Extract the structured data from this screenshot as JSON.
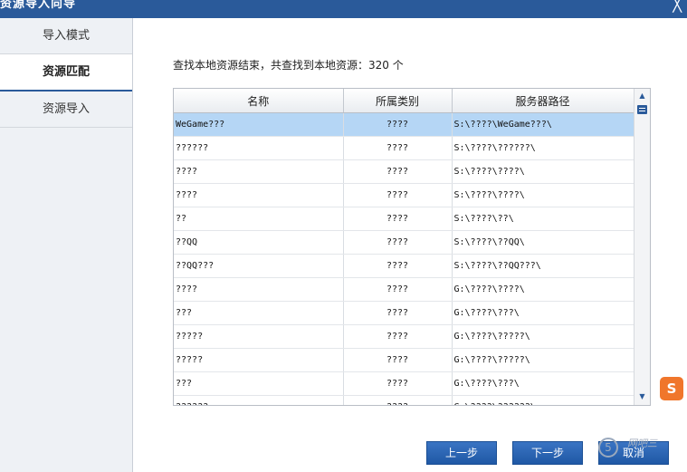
{
  "window": {
    "title": "资源导入向导",
    "close_glyph": "╳"
  },
  "sidebar": {
    "items": [
      {
        "label": "导入模式",
        "active": false
      },
      {
        "label": "资源匹配",
        "active": true
      },
      {
        "label": "资源导入",
        "active": false
      }
    ]
  },
  "summary": "查找本地资源结束，共查找到本地资源：320 个",
  "table": {
    "columns": [
      "名称",
      "所属类别",
      "服务器路径"
    ],
    "rows": [
      {
        "name": "WeGame???",
        "category": "????",
        "path": "S:\\????\\WeGame???\\"
      },
      {
        "name": "??????",
        "category": "????",
        "path": "S:\\????\\??????\\"
      },
      {
        "name": "????",
        "category": "????",
        "path": "S:\\????\\????\\"
      },
      {
        "name": "????",
        "category": "????",
        "path": "S:\\????\\????\\"
      },
      {
        "name": "??",
        "category": "????",
        "path": "S:\\????\\??\\"
      },
      {
        "name": "??QQ",
        "category": "????",
        "path": "S:\\????\\??QQ\\"
      },
      {
        "name": "??QQ???",
        "category": "????",
        "path": "S:\\????\\??QQ???\\"
      },
      {
        "name": "????",
        "category": "????",
        "path": "G:\\????\\????\\"
      },
      {
        "name": "???",
        "category": "????",
        "path": "G:\\????\\???\\"
      },
      {
        "name": "?????",
        "category": "????",
        "path": "G:\\????\\?????\\"
      },
      {
        "name": "?????",
        "category": "????",
        "path": "G:\\????\\?????\\"
      },
      {
        "name": "???",
        "category": "????",
        "path": "G:\\????\\???\\"
      },
      {
        "name": "??????",
        "category": "????",
        "path": "G:\\????\\??????\\"
      }
    ],
    "selected_index": 0
  },
  "scrollbar": {
    "up_icon": "▲",
    "down_icon": "▼"
  },
  "buttons": {
    "prev": "上一步",
    "next": "下一步",
    "cancel": "取消"
  },
  "badge": {
    "letter": "S"
  },
  "watermark": {
    "glyph": "5",
    "text": "网吧三"
  },
  "colors": {
    "accent": "#2a5a9a",
    "selected_row": "#b5d6f5",
    "button": "#2a62b0"
  }
}
